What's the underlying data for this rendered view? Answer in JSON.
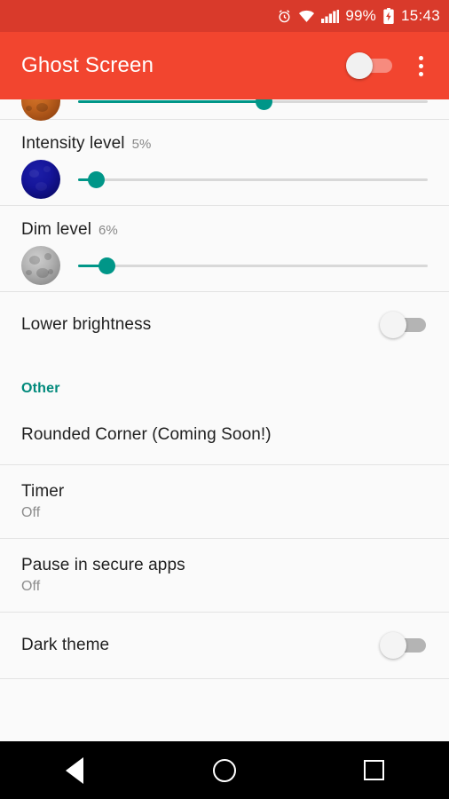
{
  "status_bar": {
    "alarm_icon": "alarm-clock-icon",
    "wifi_icon": "wifi-icon",
    "signal_icon": "cellular-signal-icon",
    "battery_percent": "99%",
    "battery_icon": "battery-charging-icon",
    "time": "15:43",
    "background_color": "#d93a2b"
  },
  "app_bar": {
    "title": "Ghost Screen",
    "master_switch_on": false,
    "overflow_icon": "overflow-menu-icon",
    "background_color": "#f2452f"
  },
  "sliders": [
    {
      "label": "",
      "percent_label": "",
      "icon": "blood-moon-icon",
      "value_percent": 53,
      "partially_scrolled": true
    },
    {
      "label": "Intensity level",
      "percent_label": "5%",
      "icon": "blue-moon-icon",
      "value_percent": 5
    },
    {
      "label": "Dim level",
      "percent_label": "6%",
      "icon": "gray-moon-icon",
      "value_percent": 8
    }
  ],
  "lower_brightness": {
    "label": "Lower brightness",
    "enabled": false
  },
  "other_section": {
    "header": "Other",
    "header_color": "#00897b",
    "items": [
      {
        "label": "Rounded Corner (Coming Soon!)",
        "sub": ""
      },
      {
        "label": "Timer",
        "sub": "Off"
      },
      {
        "label": "Pause in secure apps",
        "sub": "Off"
      }
    ]
  },
  "dark_theme": {
    "label": "Dark theme",
    "enabled": false
  },
  "nav_bar": {
    "back_icon": "back-triangle-icon",
    "home_icon": "home-circle-icon",
    "recents_icon": "recents-square-icon"
  },
  "accent_color": "#009688"
}
